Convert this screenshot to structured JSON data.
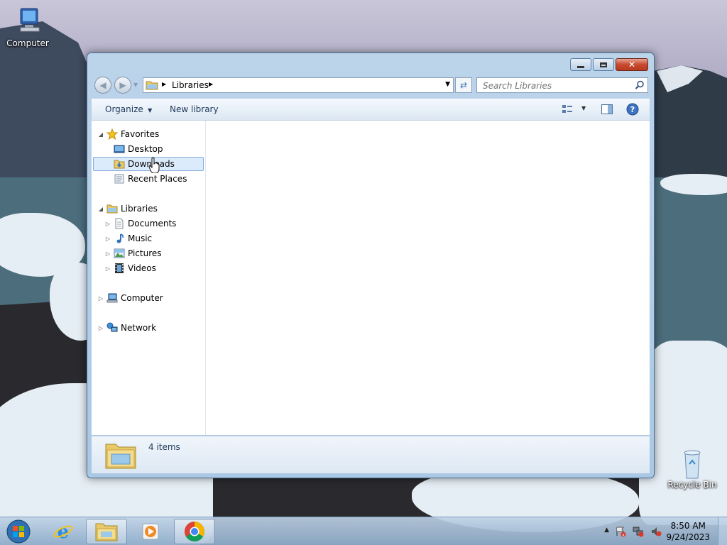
{
  "desktop": {
    "icons": [
      {
        "label": "Computer"
      },
      {
        "label": "Recycle Bin"
      }
    ]
  },
  "window": {
    "address": {
      "crumb": "Libraries"
    },
    "search": {
      "placeholder": "Search Libraries"
    },
    "toolbar": {
      "organize_label": "Organize",
      "new_library_label": "New library"
    },
    "nav_pane": {
      "favorites": {
        "label": "Favorites",
        "items": [
          "Desktop",
          "Downloads",
          "Recent Places"
        ],
        "selected": "Downloads"
      },
      "libraries": {
        "label": "Libraries",
        "items": [
          "Documents",
          "Music",
          "Pictures",
          "Videos"
        ]
      },
      "computer": {
        "label": "Computer"
      },
      "network": {
        "label": "Network"
      }
    },
    "status": {
      "item_count": "4 items"
    }
  },
  "taskbar": {
    "clock": {
      "time": "8:50 AM",
      "date": "9/24/2023"
    },
    "pinned": [
      "start-orb",
      "internet-explorer",
      "windows-explorer",
      "media-player",
      "chrome"
    ]
  },
  "colors": {
    "accent": "#3a6fb0",
    "selection": "#dcebfc",
    "selection_border": "#84acdd"
  }
}
